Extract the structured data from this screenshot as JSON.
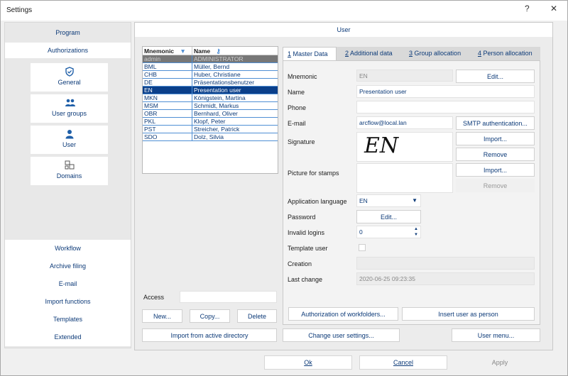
{
  "window": {
    "title": "Settings",
    "help": "?",
    "close": "✕"
  },
  "nav": {
    "top": [
      {
        "label": "Program"
      },
      {
        "label": "Authorizations"
      }
    ],
    "tiles": [
      {
        "label": "General",
        "icon": "shield-icon"
      },
      {
        "label": "User groups",
        "icon": "users-icon"
      },
      {
        "label": "User",
        "icon": "user-icon"
      },
      {
        "label": "Domains",
        "icon": "domains-icon"
      }
    ],
    "bottom": [
      {
        "label": "Workflow"
      },
      {
        "label": "Archive filing"
      },
      {
        "label": "E-mail"
      },
      {
        "label": "Import functions"
      },
      {
        "label": "Templates"
      },
      {
        "label": "Extended"
      }
    ]
  },
  "header": "User",
  "grid": {
    "columns": [
      "Mnemonic",
      "Name"
    ],
    "rows": [
      [
        "admin",
        "ADMINISTRATOR"
      ],
      [
        "BML",
        "Müller, Bernd"
      ],
      [
        "CHB",
        "Huber, Christiane"
      ],
      [
        "DE",
        "Präsentationsbenutzer"
      ],
      [
        "EN",
        "Presentation user"
      ],
      [
        "MKN",
        "Königstein, Martina"
      ],
      [
        "MSM",
        "Schmidt, Markus"
      ],
      [
        "OBR",
        "Bernhard, Oliver"
      ],
      [
        "PKL",
        "Klopf, Peter"
      ],
      [
        "PST",
        "Streicher, Patrick"
      ],
      [
        "SDO",
        "Dolz, Silvia"
      ]
    ]
  },
  "access_label": "Access",
  "left_buttons": {
    "new": "New...",
    "copy": "Copy...",
    "delete": "Delete",
    "import_ad": "Import from active directory"
  },
  "tabs": [
    {
      "num": "1",
      "label": "Master Data"
    },
    {
      "num": "2",
      "label": "Additional data"
    },
    {
      "num": "3",
      "label": "Group allocation"
    },
    {
      "num": "4",
      "label": "Person allocation"
    }
  ],
  "form": {
    "mnemonic_label": "Mnemonic",
    "mnemonic_value": "EN",
    "name_label": "Name",
    "name_value": "Presentation user",
    "phone_label": "Phone",
    "phone_value": "",
    "email_label": "E-mail",
    "email_value": "arcflow@local.lan",
    "signature_label": "Signature",
    "signature_text": "EN",
    "stamp_label": "Picture for stamps",
    "language_label": "Application language",
    "language_value": "EN",
    "password_label": "Password",
    "invalid_label": "Invalid logins",
    "invalid_value": "0",
    "template_label": "Template user",
    "creation_label": "Creation",
    "creation_value": "",
    "lastchange_label": "Last change",
    "lastchange_value": "2020-06-25 09:23:35"
  },
  "form_buttons": {
    "edit": "Edit...",
    "smtp": "SMTP authentication...",
    "import_sig": "Import...",
    "remove_sig": "Remove",
    "import_stamp": "Import...",
    "remove_stamp": "Remove",
    "edit_password": "Edit...",
    "auth_workfolders": "Authorization of workfolders...",
    "insert_person": "Insert user as person"
  },
  "bottom_buttons": {
    "change_settings": "Change user settings...",
    "user_menu": "User menu..."
  },
  "footer": {
    "ok": "Ok",
    "cancel": "Cancel",
    "apply": "Apply"
  }
}
